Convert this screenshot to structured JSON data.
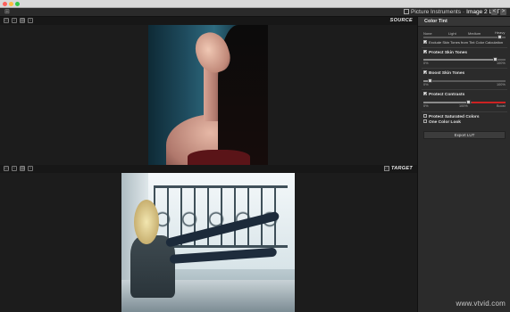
{
  "app": {
    "name": "Picture Instruments",
    "separator": "-",
    "document": "Image 2 LUT",
    "prev": "<",
    "next": ">"
  },
  "source": {
    "label": "SOURCE",
    "tools": [
      "▭",
      "‹",
      "▤",
      "›"
    ]
  },
  "target": {
    "label": "TARGET",
    "small_btn": "▭",
    "tools": [
      "▭",
      "‹",
      "▤",
      "›"
    ]
  },
  "panel": {
    "title": "Color Tint",
    "tint_levels": [
      "None",
      "Light",
      "Medium",
      "Heavy"
    ],
    "tint_value": 0.95,
    "exclude_skin": "Exclude Skin Tones from Tint Color Calculation",
    "protect_skin": {
      "title": "Protect Skin Tones",
      "min": "0%",
      "max": "100%",
      "value": 0.9
    },
    "boost_skin": {
      "title": "Boost Skin Tones",
      "min": "0%",
      "max": "100%",
      "value": 0.06
    },
    "protect_contrasts": {
      "title": "Protect Contrasts",
      "min": "0%",
      "mid": "100%",
      "max": "Boost",
      "value": 0.55
    },
    "protect_saturated": "Protect Saturated Colors",
    "one_color_look": "One Color Look",
    "export_button": "Export LUT"
  },
  "watermark": "www.vtvid.com"
}
